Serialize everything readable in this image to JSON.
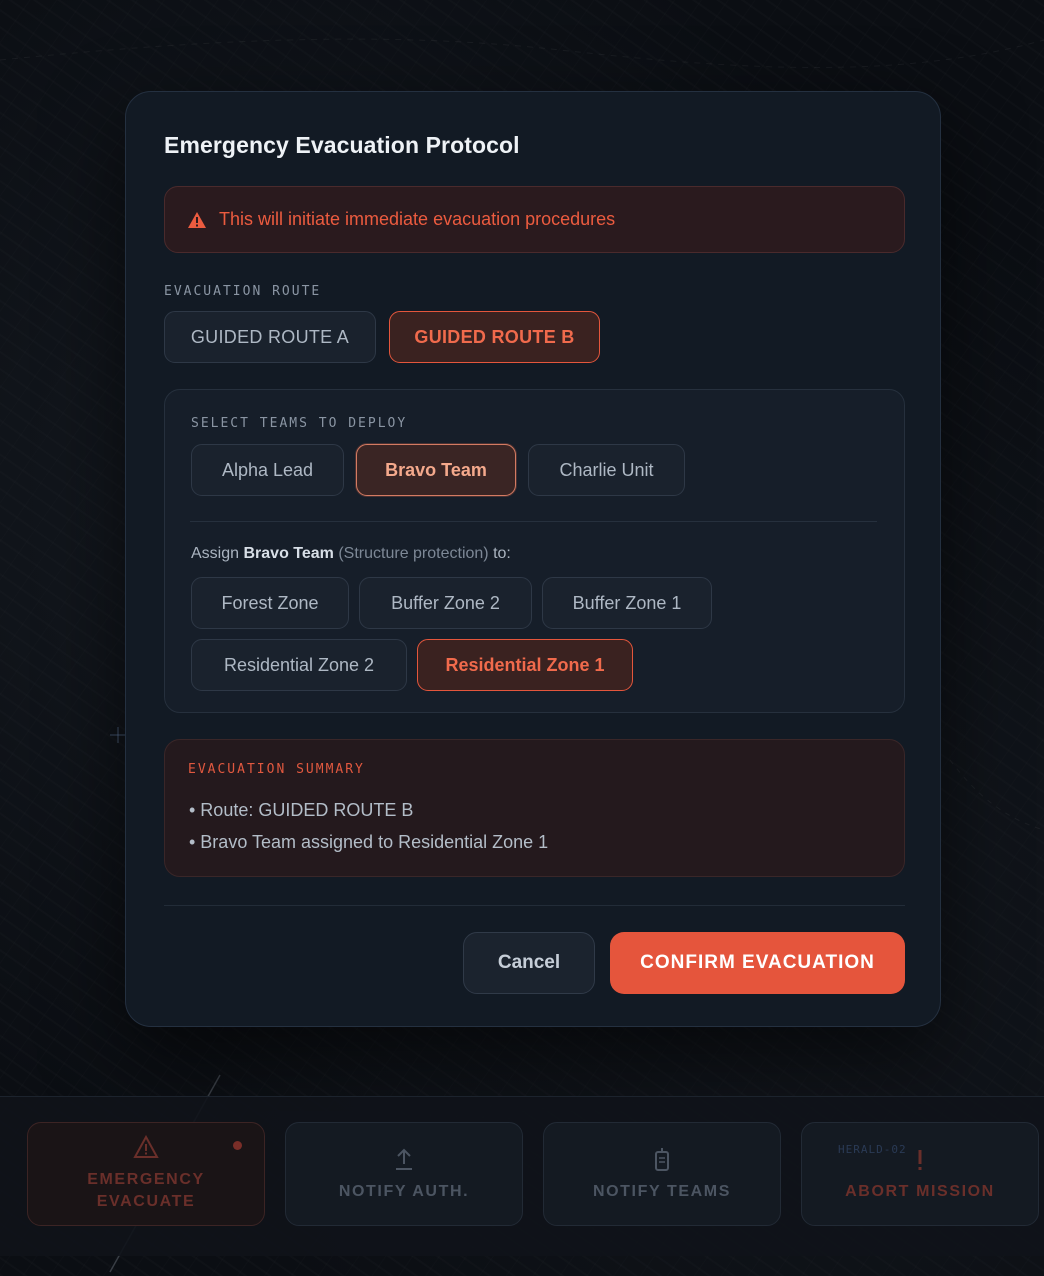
{
  "modal": {
    "title": "Emergency Evacuation Protocol",
    "warning": "This will initiate immediate evacuation procedures"
  },
  "route": {
    "label": "EVACUATION ROUTE",
    "options": [
      "GUIDED ROUTE A",
      "GUIDED ROUTE B"
    ],
    "selected": "GUIDED ROUTE B"
  },
  "teams": {
    "label": "SELECT TEAMS TO DEPLOY",
    "options": [
      "Alpha Lead",
      "Bravo Team",
      "Charlie Unit"
    ],
    "selected": "Bravo Team"
  },
  "assign": {
    "prefix": "Assign",
    "team": "Bravo Team",
    "role": "(Structure protection)",
    "suffix": "to:",
    "zones": [
      "Forest Zone",
      "Buffer Zone 2",
      "Buffer Zone 1",
      "Residential Zone 2",
      "Residential Zone 1"
    ],
    "selected": "Residential Zone 1"
  },
  "summary": {
    "label": "EVACUATION SUMMARY",
    "items": [
      "• Route: GUIDED ROUTE B",
      "• Bravo Team assigned to Residential Zone 1"
    ]
  },
  "footer": {
    "cancel": "Cancel",
    "confirm": "CONFIRM EVACUATION"
  },
  "actions": {
    "items": [
      {
        "label": "EMERGENCY EVACUATE",
        "icon": "warning-icon"
      },
      {
        "label": "NOTIFY AUTH.",
        "icon": "upload-icon"
      },
      {
        "label": "NOTIFY TEAMS",
        "icon": "radio-icon"
      },
      {
        "label": "ABORT MISSION",
        "icon": "exclamation-icon"
      }
    ],
    "callsign": "HERALD-02"
  },
  "colors": {
    "accent": "#e5553c",
    "panel": "#121a24",
    "warning_text": "#ec5b3f"
  }
}
